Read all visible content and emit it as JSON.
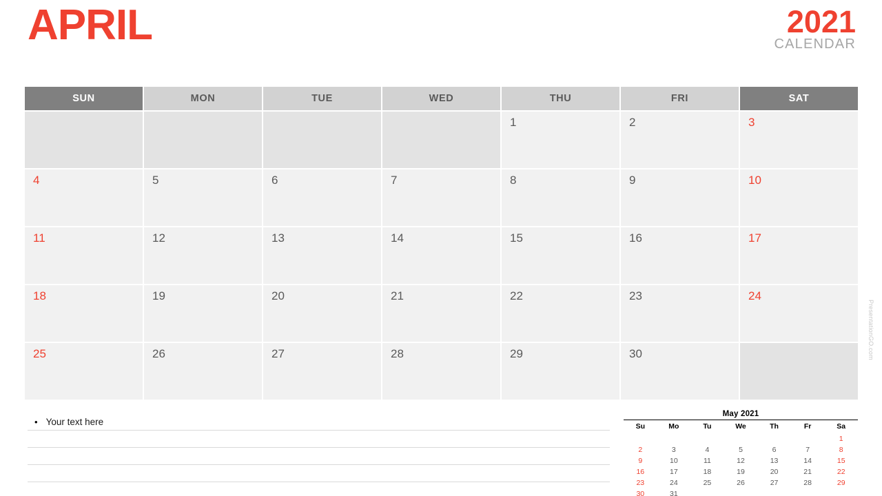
{
  "header": {
    "month": "APRIL",
    "year": "2021",
    "subtitle": "CALENDAR"
  },
  "colors": {
    "accent_red": "#ef4130",
    "header_dark": "#808080",
    "header_light": "#d2d2d2",
    "cell_bg": "#f1f1f1",
    "cell_blank_bg": "#e3e3e3",
    "weekday_text": "#595959",
    "subtitle_gray": "#a6a6a6"
  },
  "calendar": {
    "weekday_headers": [
      {
        "label": "SUN",
        "weekend": true
      },
      {
        "label": "MON",
        "weekend": false
      },
      {
        "label": "TUE",
        "weekend": false
      },
      {
        "label": "WED",
        "weekend": false
      },
      {
        "label": "THU",
        "weekend": false
      },
      {
        "label": "FRI",
        "weekend": false
      },
      {
        "label": "SAT",
        "weekend": true
      }
    ],
    "weeks": [
      [
        {
          "day": "",
          "kind": "blank"
        },
        {
          "day": "",
          "kind": "blank"
        },
        {
          "day": "",
          "kind": "blank"
        },
        {
          "day": "",
          "kind": "blank"
        },
        {
          "day": "1",
          "kind": "weekday"
        },
        {
          "day": "2",
          "kind": "weekday"
        },
        {
          "day": "3",
          "kind": "sat"
        }
      ],
      [
        {
          "day": "4",
          "kind": "sun"
        },
        {
          "day": "5",
          "kind": "weekday"
        },
        {
          "day": "6",
          "kind": "weekday"
        },
        {
          "day": "7",
          "kind": "weekday"
        },
        {
          "day": "8",
          "kind": "weekday"
        },
        {
          "day": "9",
          "kind": "weekday"
        },
        {
          "day": "10",
          "kind": "sat"
        }
      ],
      [
        {
          "day": "11",
          "kind": "sun"
        },
        {
          "day": "12",
          "kind": "weekday"
        },
        {
          "day": "13",
          "kind": "weekday"
        },
        {
          "day": "14",
          "kind": "weekday"
        },
        {
          "day": "15",
          "kind": "weekday"
        },
        {
          "day": "16",
          "kind": "weekday"
        },
        {
          "day": "17",
          "kind": "sat"
        }
      ],
      [
        {
          "day": "18",
          "kind": "sun"
        },
        {
          "day": "19",
          "kind": "weekday"
        },
        {
          "day": "20",
          "kind": "weekday"
        },
        {
          "day": "21",
          "kind": "weekday"
        },
        {
          "day": "22",
          "kind": "weekday"
        },
        {
          "day": "23",
          "kind": "weekday"
        },
        {
          "day": "24",
          "kind": "sat"
        }
      ],
      [
        {
          "day": "25",
          "kind": "sun"
        },
        {
          "day": "26",
          "kind": "weekday"
        },
        {
          "day": "27",
          "kind": "weekday"
        },
        {
          "day": "28",
          "kind": "weekday"
        },
        {
          "day": "29",
          "kind": "weekday"
        },
        {
          "day": "30",
          "kind": "weekday"
        },
        {
          "day": "",
          "kind": "blank"
        }
      ]
    ]
  },
  "notes": {
    "bullet_glyph": "•",
    "first_line_text": "Your text here",
    "line_count": 5
  },
  "mini_calendar": {
    "title": "May 2021",
    "dow": [
      "Su",
      "Mo",
      "Tu",
      "We",
      "Th",
      "Fr",
      "Sa"
    ],
    "cells": [
      {
        "day": "",
        "weekend": false
      },
      {
        "day": "",
        "weekend": false
      },
      {
        "day": "",
        "weekend": false
      },
      {
        "day": "",
        "weekend": false
      },
      {
        "day": "",
        "weekend": false
      },
      {
        "day": "",
        "weekend": false
      },
      {
        "day": "1",
        "weekend": true
      },
      {
        "day": "2",
        "weekend": true
      },
      {
        "day": "3",
        "weekend": false
      },
      {
        "day": "4",
        "weekend": false
      },
      {
        "day": "5",
        "weekend": false
      },
      {
        "day": "6",
        "weekend": false
      },
      {
        "day": "7",
        "weekend": false
      },
      {
        "day": "8",
        "weekend": true
      },
      {
        "day": "9",
        "weekend": true
      },
      {
        "day": "10",
        "weekend": false
      },
      {
        "day": "11",
        "weekend": false
      },
      {
        "day": "12",
        "weekend": false
      },
      {
        "day": "13",
        "weekend": false
      },
      {
        "day": "14",
        "weekend": false
      },
      {
        "day": "15",
        "weekend": true
      },
      {
        "day": "16",
        "weekend": true
      },
      {
        "day": "17",
        "weekend": false
      },
      {
        "day": "18",
        "weekend": false
      },
      {
        "day": "19",
        "weekend": false
      },
      {
        "day": "20",
        "weekend": false
      },
      {
        "day": "21",
        "weekend": false
      },
      {
        "day": "22",
        "weekend": true
      },
      {
        "day": "23",
        "weekend": true
      },
      {
        "day": "24",
        "weekend": false
      },
      {
        "day": "25",
        "weekend": false
      },
      {
        "day": "26",
        "weekend": false
      },
      {
        "day": "27",
        "weekend": false
      },
      {
        "day": "28",
        "weekend": false
      },
      {
        "day": "29",
        "weekend": true
      },
      {
        "day": "30",
        "weekend": true
      },
      {
        "day": "31",
        "weekend": false
      },
      {
        "day": "",
        "weekend": false
      },
      {
        "day": "",
        "weekend": false
      },
      {
        "day": "",
        "weekend": false
      },
      {
        "day": "",
        "weekend": false
      },
      {
        "day": "",
        "weekend": true
      }
    ]
  },
  "watermark": {
    "text": "PresentationGO.com"
  }
}
